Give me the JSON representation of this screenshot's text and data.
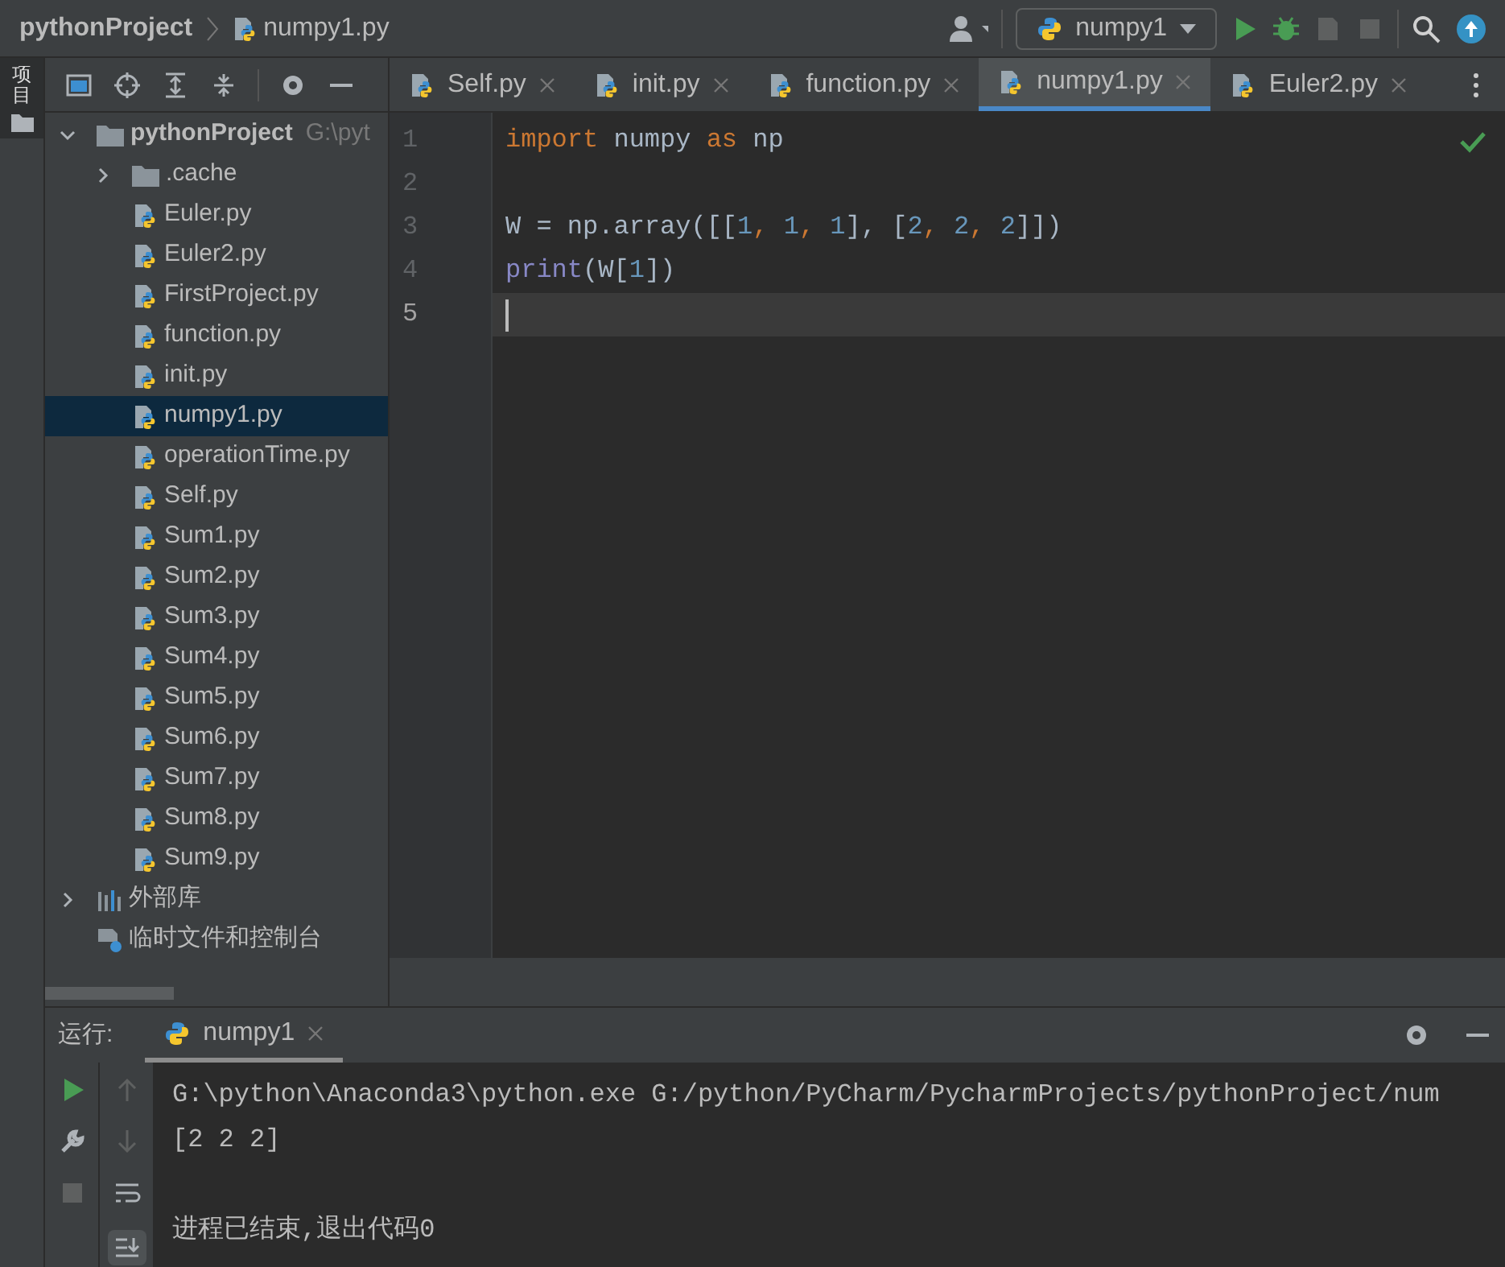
{
  "breadcrumb": [
    {
      "label": "pythonProject",
      "kind": "project"
    },
    {
      "label": "numpy1.py",
      "kind": "python"
    }
  ],
  "run_config": {
    "label": "numpy1"
  },
  "side_strip": {
    "label": "项目"
  },
  "editor_tabs": [
    {
      "label": "Self.py",
      "selected": false
    },
    {
      "label": "init.py",
      "selected": false
    },
    {
      "label": "function.py",
      "selected": false
    },
    {
      "label": "numpy1.py",
      "selected": true
    },
    {
      "label": "Euler2.py",
      "selected": false
    }
  ],
  "project_tree": [
    {
      "label": "pythonProject",
      "path": "G:\\pyt",
      "kind": "folder",
      "expanded": true,
      "selected": false,
      "children": [
        {
          "label": ".cache",
          "kind": "folder",
          "expanded": false,
          "selected": false
        },
        {
          "label": "Euler.py",
          "kind": "python",
          "selected": false
        },
        {
          "label": "Euler2.py",
          "kind": "python",
          "selected": false
        },
        {
          "label": "FirstProject.py",
          "kind": "python",
          "selected": false
        },
        {
          "label": "function.py",
          "kind": "python",
          "selected": false
        },
        {
          "label": "init.py",
          "kind": "python",
          "selected": false
        },
        {
          "label": "numpy1.py",
          "kind": "python",
          "selected": true
        },
        {
          "label": "operationTime.py",
          "kind": "python",
          "selected": false
        },
        {
          "label": "Self.py",
          "kind": "python",
          "selected": false
        },
        {
          "label": "Sum1.py",
          "kind": "python",
          "selected": false
        },
        {
          "label": "Sum2.py",
          "kind": "python",
          "selected": false
        },
        {
          "label": "Sum3.py",
          "kind": "python",
          "selected": false
        },
        {
          "label": "Sum4.py",
          "kind": "python",
          "selected": false
        },
        {
          "label": "Sum5.py",
          "kind": "python",
          "selected": false
        },
        {
          "label": "Sum6.py",
          "kind": "python",
          "selected": false
        },
        {
          "label": "Sum7.py",
          "kind": "python",
          "selected": false
        },
        {
          "label": "Sum8.py",
          "kind": "python",
          "selected": false
        },
        {
          "label": "Sum9.py",
          "kind": "python",
          "selected": false
        }
      ]
    },
    {
      "label": "外部库",
      "kind": "library",
      "expanded": false,
      "selected": false
    },
    {
      "label": "临时文件和控制台",
      "kind": "scratch",
      "selected": false
    }
  ],
  "code_lines": [
    {
      "number": "1",
      "current": false,
      "tokens": [
        {
          "text": "import",
          "kind": "keyword"
        },
        {
          "text": " numpy ",
          "kind": "plain"
        },
        {
          "text": "as",
          "kind": "keyword"
        },
        {
          "text": " np",
          "kind": "plain"
        }
      ]
    },
    {
      "number": "2",
      "current": false
    },
    {
      "number": "3",
      "current": false,
      "tokens": [
        {
          "text": "W = np.array([[",
          "kind": "plain"
        },
        {
          "text": "1",
          "kind": "number"
        },
        {
          "text": ", ",
          "kind": "keyword"
        },
        {
          "text": "1",
          "kind": "number"
        },
        {
          "text": ", ",
          "kind": "keyword"
        },
        {
          "text": "1",
          "kind": "number"
        },
        {
          "text": "], ",
          "kind": "plain"
        },
        {
          "text": "[",
          "kind": "plain"
        },
        {
          "text": "2",
          "kind": "number"
        },
        {
          "text": ", ",
          "kind": "keyword"
        },
        {
          "text": "2",
          "kind": "number"
        },
        {
          "text": ", ",
          "kind": "keyword"
        },
        {
          "text": "2",
          "kind": "number"
        },
        {
          "text": "]])",
          "kind": "plain"
        }
      ]
    },
    {
      "number": "4",
      "current": false,
      "tokens": [
        {
          "text": "print",
          "kind": "builtin"
        },
        {
          "text": "(W[",
          "kind": "plain"
        },
        {
          "text": "1",
          "kind": "number"
        },
        {
          "text": "])",
          "kind": "plain"
        }
      ]
    },
    {
      "number": "5",
      "current": true
    }
  ],
  "run_panel": {
    "label": "运行:",
    "tabs": [
      {
        "label": "numpy1",
        "selected": true
      }
    ],
    "output": [
      {
        "kind": "line",
        "text": "G:\\python\\Anaconda3\\python.exe G:/python/PyCharm/PycharmProjects/pythonProject/num"
      },
      {
        "kind": "line",
        "text": "[2 2 2]"
      },
      {
        "kind": "blank"
      },
      {
        "kind": "line",
        "text": "进程已结束,退出代码0"
      }
    ]
  }
}
